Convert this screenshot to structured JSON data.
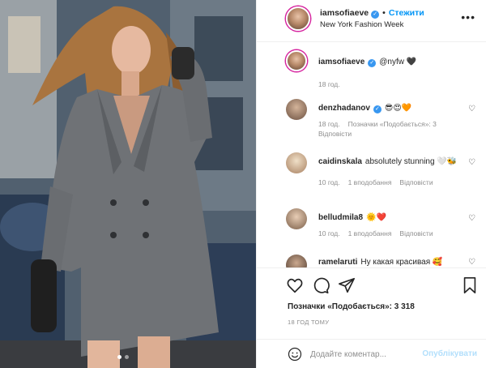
{
  "post": {
    "username": "iamsofiaeve",
    "verified": true,
    "follow_label": "Стежити",
    "location": "New York Fashion Week",
    "more_icon": "more-horizontal-icon"
  },
  "caption": {
    "username": "iamsofiaeve",
    "text": "@nyfw 🖤",
    "time": "18 год."
  },
  "comments": [
    {
      "username": "denzhadanov",
      "verified": true,
      "text": "😎😍🧡",
      "time": "18 год.",
      "likes": "Позначки «Подобається»: 3",
      "reply": "Відповісти"
    },
    {
      "username": "caidinskala",
      "verified": false,
      "text": "absolutely stunning 🤍🐝",
      "time": "10 год.",
      "likes": "1 вподобання",
      "reply": "Відповісти"
    },
    {
      "username": "belludmila8",
      "verified": false,
      "text": "🌞❤️",
      "time": "10 год.",
      "likes": "1 вподобання",
      "reply": "Відповісти"
    },
    {
      "username": "ramelaruti",
      "verified": false,
      "text": "Ну какая красивая 🥰",
      "time": "",
      "likes": "",
      "reply": ""
    }
  ],
  "actions": {
    "like_icon": "heart-icon",
    "comment_icon": "comment-icon",
    "share_icon": "share-icon",
    "save_icon": "bookmark-icon"
  },
  "likes_text": "Позначки «Подобається»: 3 318",
  "time_ago": "18 ГОД ТОМУ",
  "composer": {
    "placeholder": "Додайте коментар...",
    "post_label": "Опублікувати",
    "emoji_icon": "smiley-icon"
  },
  "carousel": {
    "count": 2,
    "active": 1
  },
  "colors": {
    "link_blue": "#0095f6",
    "verified_blue": "#3897f0",
    "muted": "#8e8e8e",
    "disabled_blue": "#b2dffc"
  }
}
